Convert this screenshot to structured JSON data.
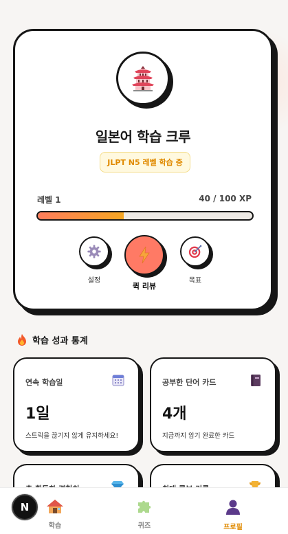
{
  "profile": {
    "crew_name": "일본어 학습 크루",
    "level_badge": "JLPT N5 레벨 학습 중",
    "level_label": "레벨 1",
    "xp_text": "40 / 100 XP",
    "xp_progress": 0.4,
    "avatar_icon": "pagoda-icon"
  },
  "actions": {
    "settings_label": "설정",
    "quick_review_label": "퀵 리뷰",
    "goal_label": "목표"
  },
  "stats_section": {
    "title": "학습 성과 통계",
    "cards": [
      {
        "title": "연속 학습일",
        "value": "1일",
        "desc": "스트릭을 끊기지 않게 유지하세요!",
        "icon": "calendar-icon"
      },
      {
        "title": "공부한 단어 카드",
        "value": "4개",
        "desc": "지금까지 암기 완료한 카드",
        "icon": "book-icon"
      },
      {
        "title": "총 획득한 경험치",
        "icon": "gem-icon"
      },
      {
        "title": "최대 콤보 기록",
        "icon": "trophy-icon"
      }
    ]
  },
  "nav": {
    "items": [
      {
        "label": "학습",
        "icon": "house-icon"
      },
      {
        "label": "퀴즈",
        "icon": "puzzle-icon"
      },
      {
        "label": "프로필",
        "icon": "person-icon"
      }
    ],
    "active_color": "#e08a00"
  },
  "floating_badge": "N"
}
